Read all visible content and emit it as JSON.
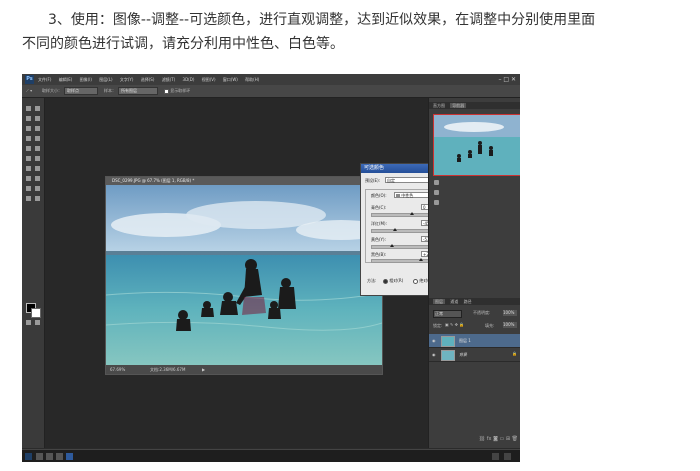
{
  "article": {
    "line1": "3、使用：图像--调整--可选颜色，进行直观调整，达到近似效果，在调整中分别使用里面",
    "line2": "不同的颜色进行试调，请充分利用中性色、白色等。"
  },
  "menubar": {
    "logo": "Ps",
    "menus": [
      "文件(F)",
      "编辑(E)",
      "图像(I)",
      "图层(L)",
      "文字(Y)",
      "选择(S)",
      "滤镜(T)",
      "3D(D)",
      "视图(V)",
      "窗口(W)",
      "帮助(H)"
    ],
    "window_controls": "–  □  ✕"
  },
  "options_bar": {
    "size_label": "取样大小：",
    "size_value": "取样点",
    "sample_label": "样本：",
    "sample_value": "所有图层",
    "ring_label": "显示取样环"
  },
  "document": {
    "title": "DSC_0299.JPG @ 67.7% (图层 1, RGB/8) *",
    "zoom": "67.69%",
    "doc_info": "文档:2.36M/6.67M"
  },
  "dialog": {
    "title": "可选颜色",
    "preset_label": "预设(E):",
    "preset_value": "自定",
    "ok_label": "确定",
    "cancel_label": "复位",
    "preview_label": "预览(P)",
    "colors_label": "颜色(O):",
    "colors_value": "中性色",
    "channels": [
      {
        "label": "青色(C):",
        "value": "0",
        "unit": "%",
        "level": 0.5
      },
      {
        "label": "洋红(M):",
        "value": "-45",
        "unit": "%",
        "level": 0.28
      },
      {
        "label": "黄色(Y):",
        "value": "-53",
        "unit": "%",
        "level": 0.24
      },
      {
        "label": "黑色(B):",
        "value": "+24",
        "unit": "%",
        "level": 0.62
      }
    ],
    "method_label": "方法:",
    "method_relative": "相对(R)",
    "method_absolute": "绝对(A)"
  },
  "panels": {
    "top_tabs": [
      "直方图",
      "导航器"
    ],
    "layer_tabs": [
      "图层",
      "通道",
      "路径"
    ],
    "blend_mode": "正常",
    "opacity_label": "不透明度:",
    "opacity_value": "100%",
    "lock_label": "锁定:",
    "fill_label": "填充:",
    "fill_value": "100%",
    "layers": [
      {
        "name": "图层 1"
      },
      {
        "name": "背景"
      }
    ]
  },
  "colors": {
    "app_bg": "#2b2b2b",
    "dialog_bg": "#eaeaea",
    "title_blue": "#2f5ba8",
    "sea": "#4fa7b6",
    "sky": "#7fa9c8"
  }
}
